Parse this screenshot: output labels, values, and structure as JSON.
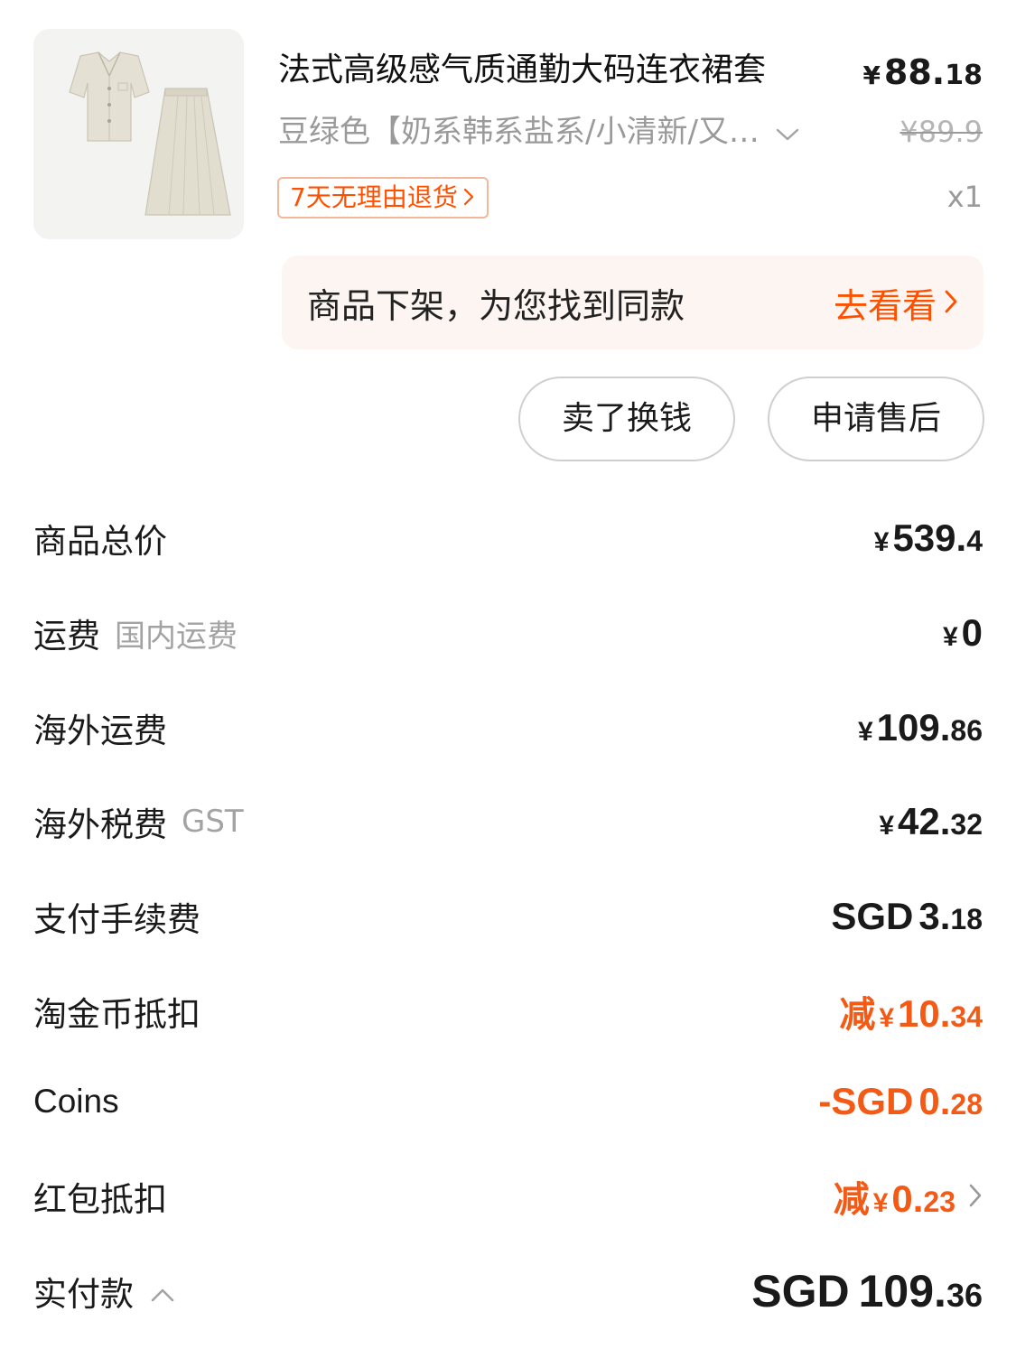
{
  "product": {
    "image_alt": "blouse and pleated skirt set",
    "title": "法式高级感气质通勤大码连衣裙套",
    "price_currency": "¥",
    "price_int": "88.",
    "price_dec": "18",
    "sku": "豆绿色【奶系韩系盐系/小清新/又…",
    "original_price": "¥89.9",
    "return_tag": "7天无理由退货",
    "quantity": "x1"
  },
  "notice": {
    "text": "商品下架，为您找到同款",
    "link": "去看看"
  },
  "actions": {
    "sell": "卖了换钱",
    "after_sale": "申请售后"
  },
  "summary": {
    "goods_total": {
      "label": "商品总价",
      "currency": "¥",
      "int": "539.",
      "dec": "4"
    },
    "shipping": {
      "label": "运费",
      "sub": "国内运费",
      "currency": "¥",
      "int": "0"
    },
    "overseas_shipping": {
      "label": "海外运费",
      "currency": "¥",
      "int": "109.",
      "dec": "86"
    },
    "overseas_tax": {
      "label": "海外税费",
      "sub": "GST",
      "currency": "¥",
      "int": "42.",
      "dec": "32"
    },
    "payment_fee": {
      "label": "支付手续费",
      "prefix": "SGD",
      "int": "3.",
      "dec": "18"
    },
    "taojin_coins": {
      "label": "淘金币抵扣",
      "prefix": "减",
      "currency": "¥",
      "int": "10.",
      "dec": "34"
    },
    "coins": {
      "label": "Coins",
      "prefix": "-SGD",
      "int": "0.",
      "dec": "28"
    },
    "red_packet": {
      "label": "红包抵扣",
      "prefix": "减",
      "currency": "¥",
      "int": "0.",
      "dec": "23"
    },
    "paid": {
      "label": "实付款",
      "prefix": "SGD",
      "int": "109.",
      "dec": "36"
    }
  },
  "colors": {
    "accent": "#ff5000",
    "deduction": "#f25a16",
    "notice_bg": "#fdf5f1"
  },
  "icons": {
    "sku_dropdown": "chevron-down-icon",
    "tag_arrow": "chevron-right-icon",
    "notice_arrow": "chevron-right-icon",
    "red_packet_arrow": "chevron-right-icon",
    "paid_toggle": "chevron-up-icon"
  }
}
